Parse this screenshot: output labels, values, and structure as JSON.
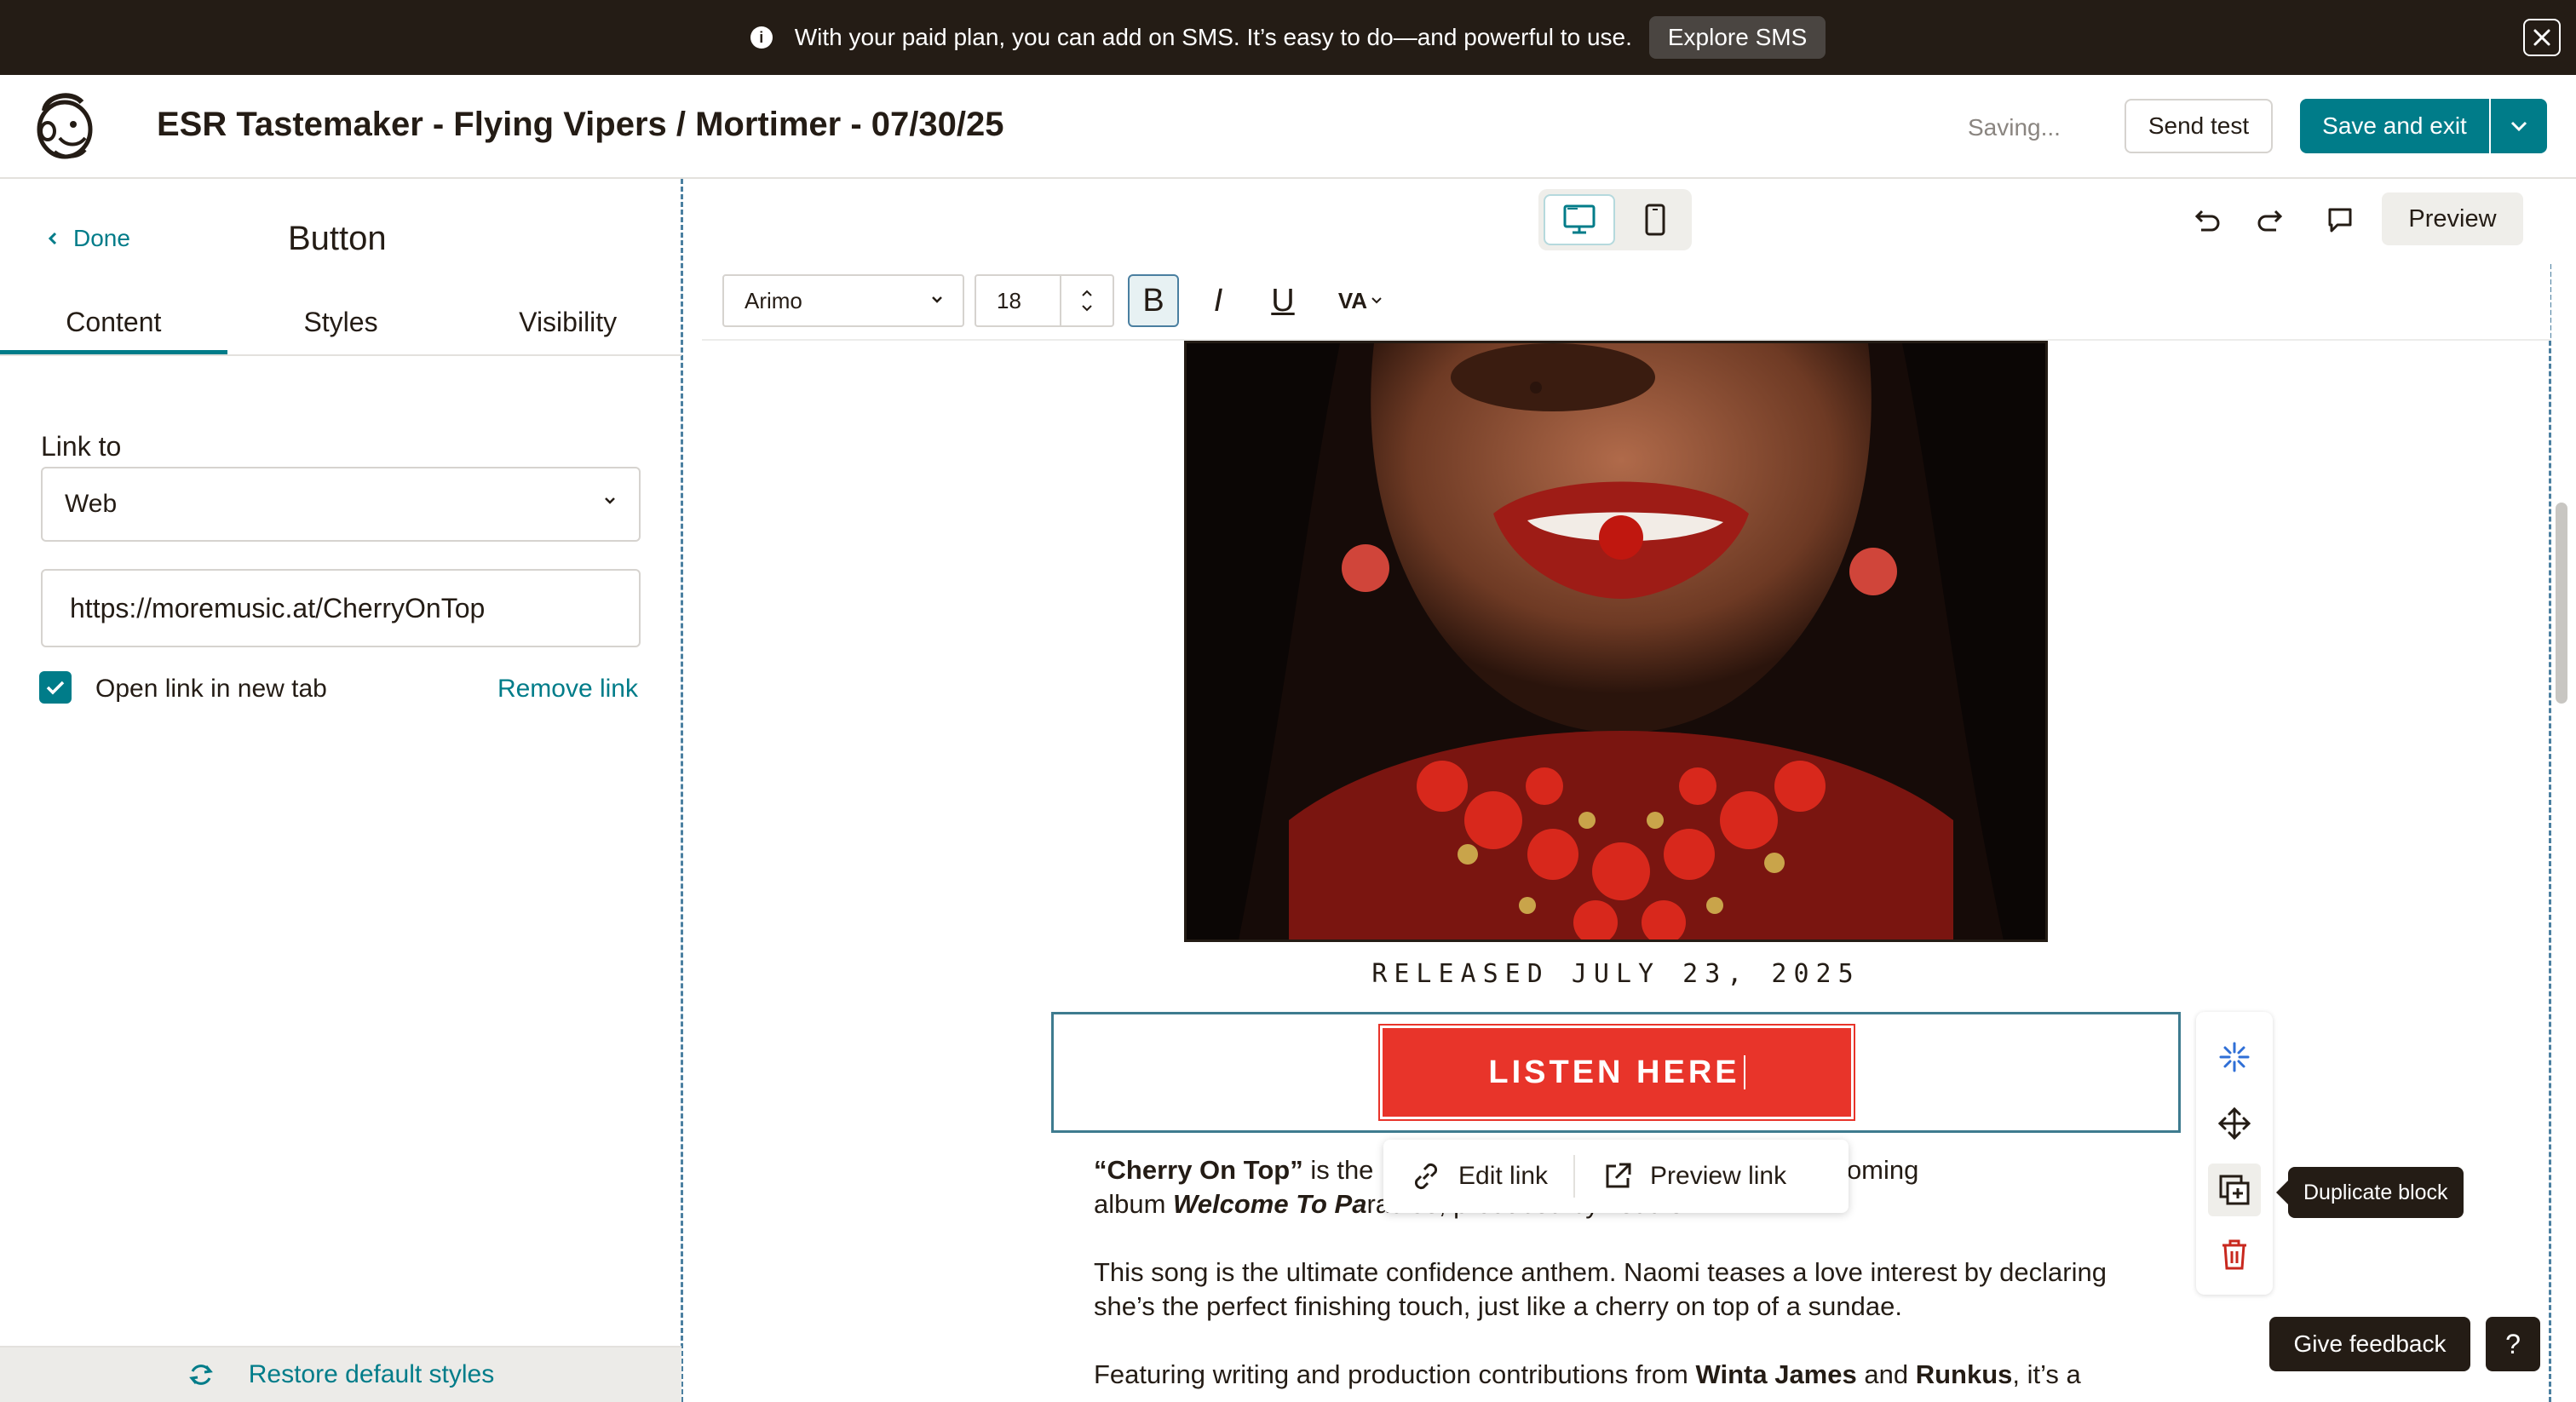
{
  "banner": {
    "message": "With your paid plan, you can add on SMS. It’s easy to do—and powerful to use.",
    "cta": "Explore SMS",
    "info_icon_glyph": "i"
  },
  "header": {
    "title": "ESR Tastemaker - Flying Vipers / Mortimer - 07/30/25",
    "status": "Saving...",
    "send_test": "Send test",
    "save_exit": "Save and exit"
  },
  "left_panel": {
    "back_label": "Done",
    "title": "Button",
    "tabs": [
      {
        "label": "Content"
      },
      {
        "label": "Styles"
      },
      {
        "label": "Visibility"
      }
    ],
    "link_to_label": "Link to",
    "link_type": "Web",
    "url_value": "https://moremusic.at/CherryOnTop",
    "open_new_tab_label": "Open link in new tab",
    "remove_link_label": "Remove link",
    "restore_label": "Restore default styles"
  },
  "toolbar": {
    "preview": "Preview",
    "font": "Arimo",
    "font_size": "18",
    "bold": "B",
    "italic": "I",
    "underline": "U",
    "spacing": "VA"
  },
  "email": {
    "release_text": "RELEASED JULY 23, 2025",
    "button_text": "LISTEN HERE",
    "popover": {
      "edit_link": "Edit link",
      "preview_link": "Preview link"
    },
    "para1": {
      "bold1": "“Cherry On Top”",
      "t1": " is the",
      "t2": "coming",
      "t3": "album ",
      "boldital": "Welcome To Pa",
      "t4": "radise, produced by Teddie T."
    },
    "para2": "This song is the ultimate confidence anthem. Naomi teases a love interest by declaring she’s the perfect finishing touch, just like a cherry on top of a sundae.",
    "para3": {
      "t1": "Featuring writing and production contributions from ",
      "b1": "Winta James",
      "t2": " and ",
      "b2": "Runkus",
      "t3": ", it’s a"
    }
  },
  "side_tools": {
    "tooltip": "Duplicate block"
  },
  "footer": {
    "feedback": "Give feedback",
    "help": "?"
  },
  "colors": {
    "accent": "#007c89",
    "button_red": "#e8342a",
    "banner_bg": "#241c15"
  }
}
